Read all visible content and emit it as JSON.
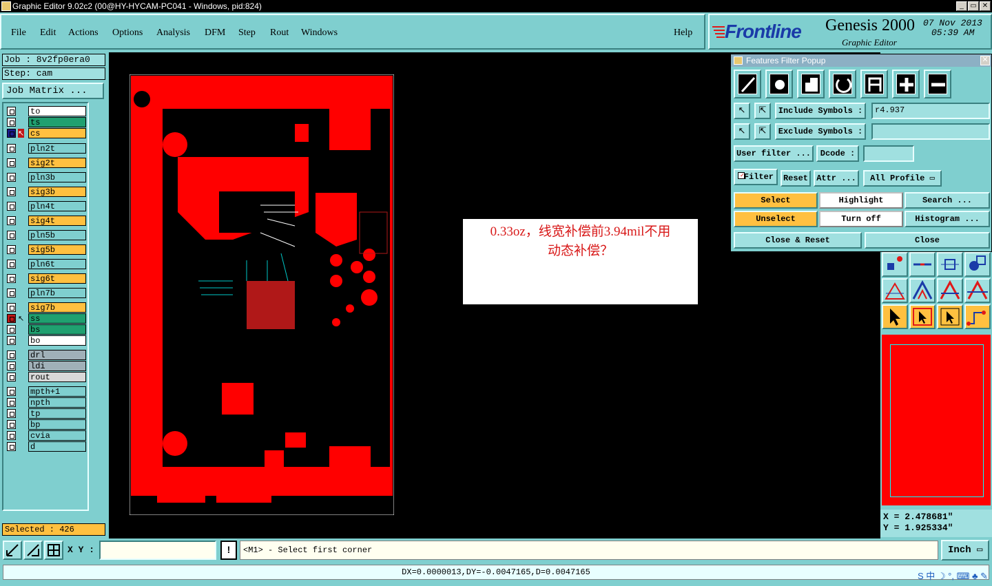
{
  "window": {
    "title": "Graphic Editor 9.02c2 (00@HY-HYCAM-PC041 - Windows, pid:824)",
    "min_label": "_",
    "max_label": "▭",
    "close_label": "✕"
  },
  "menu": [
    "File",
    "Edit",
    "Actions",
    "Options",
    "Analysis",
    "DFM",
    "Step",
    "Rout",
    "Windows"
  ],
  "help_label": "Help",
  "brand": {
    "logo": "Frontline",
    "product": "Genesis 2000",
    "subtitle": "Graphic Editor",
    "date": "07 Nov 2013",
    "time": "05:39 AM"
  },
  "job": {
    "job_text": "Job : 8v2fp0era0",
    "step_text": "Step: cam",
    "matrix_button": "Job Matrix ..."
  },
  "layers": [
    {
      "name": "to",
      "color": "#ffffff"
    },
    {
      "name": "ts",
      "color": "#20a070"
    },
    {
      "name": "cs",
      "color": "#ffc040"
    },
    {
      "name": "pln2t",
      "color": "#7fcfcf"
    },
    {
      "name": "sig2t",
      "color": "#ffc040"
    },
    {
      "name": "pln3b",
      "color": "#7fcfcf"
    },
    {
      "name": "sig3b",
      "color": "#ffc040"
    },
    {
      "name": "pln4t",
      "color": "#7fcfcf"
    },
    {
      "name": "sig4t",
      "color": "#ffc040"
    },
    {
      "name": "pln5b",
      "color": "#7fcfcf"
    },
    {
      "name": "sig5b",
      "color": "#ffc040"
    },
    {
      "name": "pln6t",
      "color": "#7fcfcf"
    },
    {
      "name": "sig6t",
      "color": "#ffc040"
    },
    {
      "name": "pln7b",
      "color": "#7fcfcf"
    },
    {
      "name": "sig7b",
      "color": "#ffc040"
    },
    {
      "name": "ss",
      "color": "#20a070"
    },
    {
      "name": "bs",
      "color": "#20a070"
    },
    {
      "name": "bo",
      "color": "#ffffff"
    },
    {
      "name": "drl",
      "color": "#a0b0b8"
    },
    {
      "name": "ldi",
      "color": "#a0b0b8"
    },
    {
      "name": "rout",
      "color": "#d8d8d8"
    },
    {
      "name": "mpth+1",
      "color": "#7fcfcf"
    },
    {
      "name": "npth",
      "color": "#7fcfcf"
    },
    {
      "name": "tp",
      "color": "#7fcfcf"
    },
    {
      "name": "bp",
      "color": "#7fcfcf"
    },
    {
      "name": "cvia",
      "color": "#7fcfcf"
    },
    {
      "name": "d",
      "color": "#7fcfcf"
    }
  ],
  "selected_text": "Selected : 426",
  "note": {
    "line1": "0.33oz，线宽补偿前3.94mil不用",
    "line2": "动态补偿？"
  },
  "filter": {
    "title": "Features Filter Popup",
    "close_label": "✕",
    "include_label": "Include Symbols :",
    "include_value": "r4.937",
    "exclude_label": "Exclude Symbols :",
    "exclude_value": "",
    "user_filter": "User filter ...",
    "dcode_label": "Dcode :",
    "dcode_value": "",
    "filter_label": "Filter",
    "reset": "Reset",
    "attr": "Attr ...",
    "profile": "All Profile",
    "select": "Select",
    "highlight": "Highlight",
    "search": "Search ...",
    "unselect": "Unselect",
    "turn_off": "Turn off",
    "histogram": "Histogram ...",
    "close_reset": "Close & Reset",
    "close": "Close"
  },
  "coords": {
    "x": "X = 2.478681\"",
    "y": "Y = 1.925334\""
  },
  "bottom": {
    "xy_label": "X Y :",
    "xy_value": "",
    "prompt": "<M1> - Select first corner",
    "unit": "Inch",
    "status": "DX=0.0000013,DY=-0.0047165,D=0.0047165"
  },
  "tray": "S 中 ☽ °, ⌨ ♣ ✎"
}
